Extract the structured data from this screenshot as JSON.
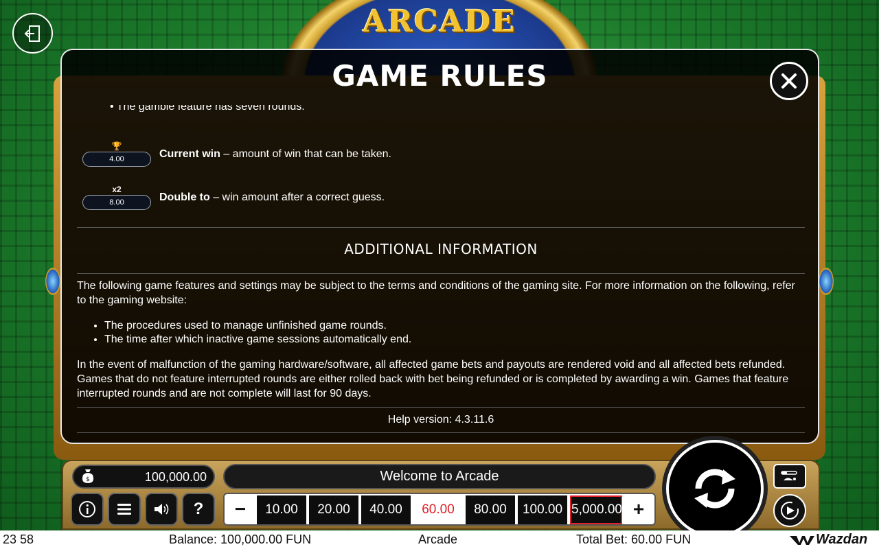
{
  "modal": {
    "title": "GAME RULES",
    "cut_text": "The gamble feature has seven rounds.",
    "features": [
      {
        "pill": "4.00",
        "glyph": "🏆",
        "name": "Current win",
        "desc": " – amount of win that can be taken."
      },
      {
        "pill": "8.00",
        "glyph": "x2",
        "name": "Double to",
        "desc": " – win amount after a correct guess."
      }
    ],
    "additional_title": "ADDITIONAL INFORMATION",
    "para1": "The following game features and settings may be subject to the terms and conditions of the gaming site. For more information on the following, refer to the gaming website:",
    "bullets": [
      "The procedures used to manage unfinished game rounds.",
      "The time after which inactive game sessions automatically end."
    ],
    "para2": "In the event of malfunction of the gaming hardware/software, all affected game bets and payouts are rendered void and all affected bets refunded. Games that do not feature interrupted rounds are either rolled back with bet being refunded or is completed by awarding a win. Games that feature interrupted rounds and are not complete will last for 90 days.",
    "help_version": "Help version: 4.3.11.6"
  },
  "logo_text": "ARCADE",
  "panel": {
    "balance": "100,000.00",
    "welcome": "Welcome to Arcade",
    "bets": [
      "10.00",
      "20.00",
      "40.00",
      "60.00",
      "80.00",
      "100.00",
      "5,000.00"
    ],
    "selected_bet": "60.00",
    "minus": "−",
    "plus": "+",
    "help_label": "?"
  },
  "status": {
    "time": "23 58",
    "balance": "Balance: 100,000.00 FUN",
    "game": "Arcade",
    "total_bet": "Total Bet: 60.00 FUN",
    "brand": "Wazdan"
  },
  "colors": {
    "accent_red": "#e0202a",
    "background_green": "#1f7a2e",
    "gold": "#d9a23c"
  }
}
